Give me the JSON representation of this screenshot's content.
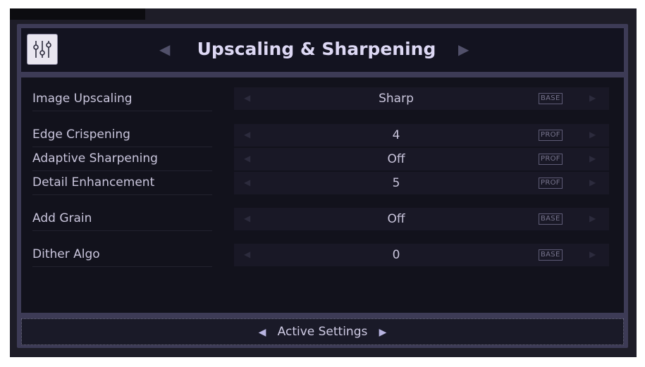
{
  "header": {
    "title": "Upscaling & Sharpening",
    "icon": "equalizer-sliders-icon",
    "prev_arrow": "◀",
    "next_arrow": "▶"
  },
  "settings": [
    {
      "label": "Image Upscaling",
      "value": "Sharp",
      "badge": "BASE"
    },
    {
      "label": "Edge Crispening",
      "value": "4",
      "badge": "PROF"
    },
    {
      "label": "Adaptive Sharpening",
      "value": "Off",
      "badge": "PROF"
    },
    {
      "label": "Detail Enhancement",
      "value": "5",
      "badge": "PROF"
    },
    {
      "label": "Add Grain",
      "value": "Off",
      "badge": "BASE"
    },
    {
      "label": "Dither Algo",
      "value": "0",
      "badge": "BASE"
    }
  ],
  "footer": {
    "label": "Active Settings",
    "prev_arrow": "◀",
    "next_arrow": "▶"
  },
  "colors": {
    "background": "#12121c",
    "panel_border": "#3d3b56",
    "text": "#c9c5dc",
    "title": "#ddd8f4"
  }
}
